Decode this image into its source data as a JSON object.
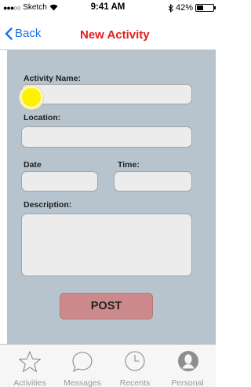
{
  "status_bar": {
    "carrier": "Sketch",
    "time": "9:41 AM",
    "battery_percent": "42%",
    "battery_level": 0.42
  },
  "nav": {
    "back_label": "Back",
    "title": "New Activity"
  },
  "form": {
    "activity_name_label": "Activity Name:",
    "activity_name_value": "",
    "location_label": "Location:",
    "location_value": "",
    "date_label": "Date",
    "date_value": "",
    "time_label": "Time:",
    "time_value": "",
    "description_label": "Description:",
    "description_value": "",
    "post_label": "POST"
  },
  "tab_bar": {
    "items": [
      {
        "label": "Activities",
        "icon": "star-icon"
      },
      {
        "label": "Messages",
        "icon": "speech-bubble-icon"
      },
      {
        "label": "Recents",
        "icon": "clock-icon"
      },
      {
        "label": "Personal",
        "icon": "person-icon"
      }
    ]
  },
  "colors": {
    "accent": "#1a73e8",
    "title": "#e02020",
    "form_background": "#b7c4ce",
    "post_button": "#cd8a8c",
    "touch_indicator": "#fff200"
  }
}
